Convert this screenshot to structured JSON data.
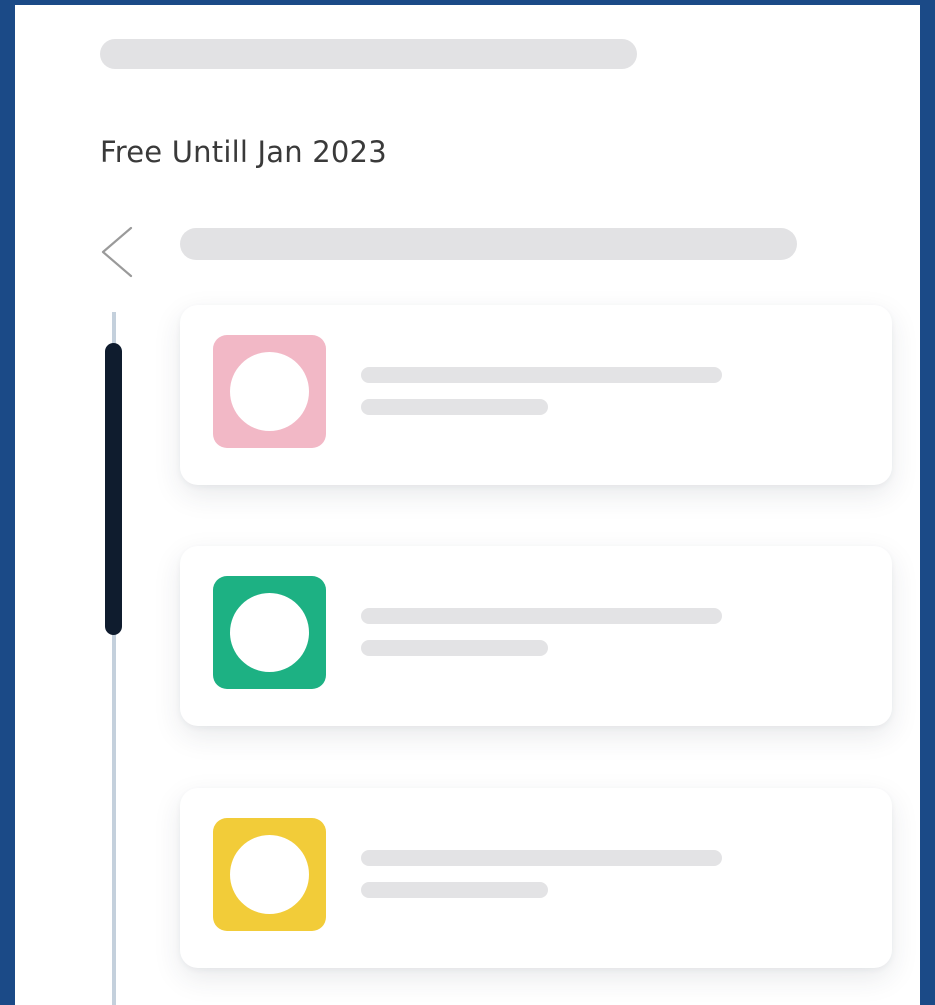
{
  "promo": {
    "text": "Free Untill Jan 2023"
  },
  "navigation": {
    "back_icon": "chevron-left-icon"
  },
  "cards": [
    {
      "icon_color": "#f2b8c6"
    },
    {
      "icon_color": "#1db183"
    },
    {
      "icon_color": "#f2cc39"
    }
  ],
  "colors": {
    "frame_border": "#1b4a87",
    "skeleton": "#e2e2e4",
    "scroll_track": "#c4d0dc",
    "scroll_thumb": "#0f1c2e"
  }
}
